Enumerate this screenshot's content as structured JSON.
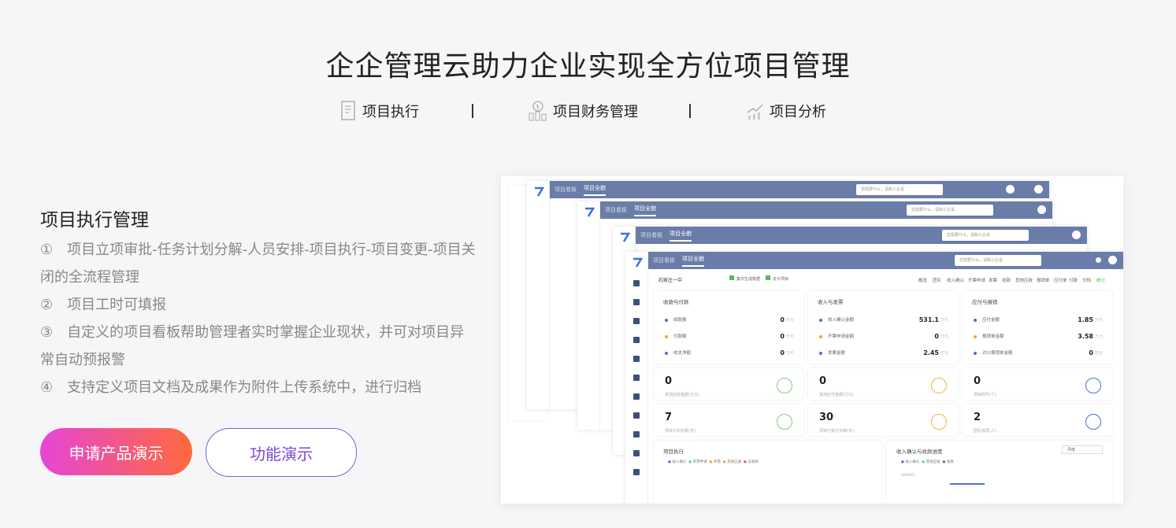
{
  "title": "企企管理云助力企业实现全方位项目管理",
  "tabs": [
    {
      "label": "项目执行",
      "icon": "document-icon"
    },
    {
      "label": "项目财务管理",
      "icon": "money-chart-icon"
    },
    {
      "label": "项目分析",
      "icon": "analysis-chart-icon"
    }
  ],
  "section": {
    "title": "项目执行管理",
    "items": [
      "①　项目立项审批-任务计划分解-人员安排-项目执行-项目变更-项目关闭的全流程管理",
      "②　项目工时可填报",
      "③　自定义的项目看板帮助管理者实时掌握企业现状，并可对项目异常自动预报警",
      "④　支持定义项目文档及成果作为附件上传系统中，进行归档"
    ]
  },
  "buttons": {
    "primary": "申请产品演示",
    "secondary": "功能演示"
  },
  "screenshot": {
    "crumb": "项目看板",
    "current_tab": "项目全貌",
    "search_placeholder": "您需要什么，请和小企说",
    "project_name": "石家庄一中",
    "filters": [
      "集中生成数据",
      "去子项目"
    ],
    "nav_tabs": [
      "概览",
      "团队",
      "收入确认",
      "开票申请",
      "发票",
      "收款",
      "其他应收",
      "报销单",
      "应付单",
      "付款",
      "文档",
      "统计"
    ],
    "cards": [
      {
        "title": "收款与付款",
        "rows": [
          {
            "label": "收款额",
            "value": "0",
            "unit": "万元",
            "color": "#4a6fd6"
          },
          {
            "label": "付款额",
            "value": "0",
            "unit": "万元",
            "color": "#f5a623"
          },
          {
            "label": "收支净额",
            "value": "0",
            "unit": "万元",
            "color": "#4a6fd6"
          }
        ]
      },
      {
        "title": "收入与发票",
        "rows": [
          {
            "label": "收入确认金额",
            "value": "531.1",
            "unit": "万元",
            "color": "#4a6fd6"
          },
          {
            "label": "开票申请金额",
            "value": "0",
            "unit": "万元",
            "color": "#f5a623"
          },
          {
            "label": "发票金额",
            "value": "2.45",
            "unit": "万元",
            "color": "#4a6fd6"
          }
        ]
      },
      {
        "title": "应付与报销",
        "rows": [
          {
            "label": "应付金额",
            "value": "1.85",
            "unit": "万元",
            "color": "#4a6fd6"
          },
          {
            "label": "报销单金额",
            "value": "3.58",
            "unit": "万元",
            "color": "#f5a623"
          },
          {
            "label": "对公报销单金额",
            "value": "0",
            "unit": "万元",
            "color": "#4a6fd6"
          }
        ]
      }
    ],
    "stats": [
      {
        "value": "0",
        "label": "其他应收金额(万元)",
        "color": "#7ec97e"
      },
      {
        "value": "0",
        "label": "其他应付金额(万元)",
        "color": "#f5b342"
      },
      {
        "value": "0",
        "label": "项目附件(个)",
        "color": "#4a6fd6"
      },
      {
        "value": "7",
        "label": "项目计划天数(天)",
        "color": "#7ec97e"
      },
      {
        "value": "30",
        "label": "项目已执行天数(天)",
        "color": "#f5b342"
      },
      {
        "value": "2",
        "label": "团队成员(人)",
        "color": "#4a6fd6"
      }
    ],
    "bottom_left": {
      "title": "项目执行",
      "legend": [
        "收入确认",
        "开票申请",
        "开票",
        "其他应收",
        "应收款"
      ]
    },
    "bottom_right": {
      "title": "收入确认与收款进度",
      "legend": [
        "收入确认",
        "其他应收",
        "收款"
      ],
      "period": "月度",
      "y_label": "600000"
    }
  }
}
